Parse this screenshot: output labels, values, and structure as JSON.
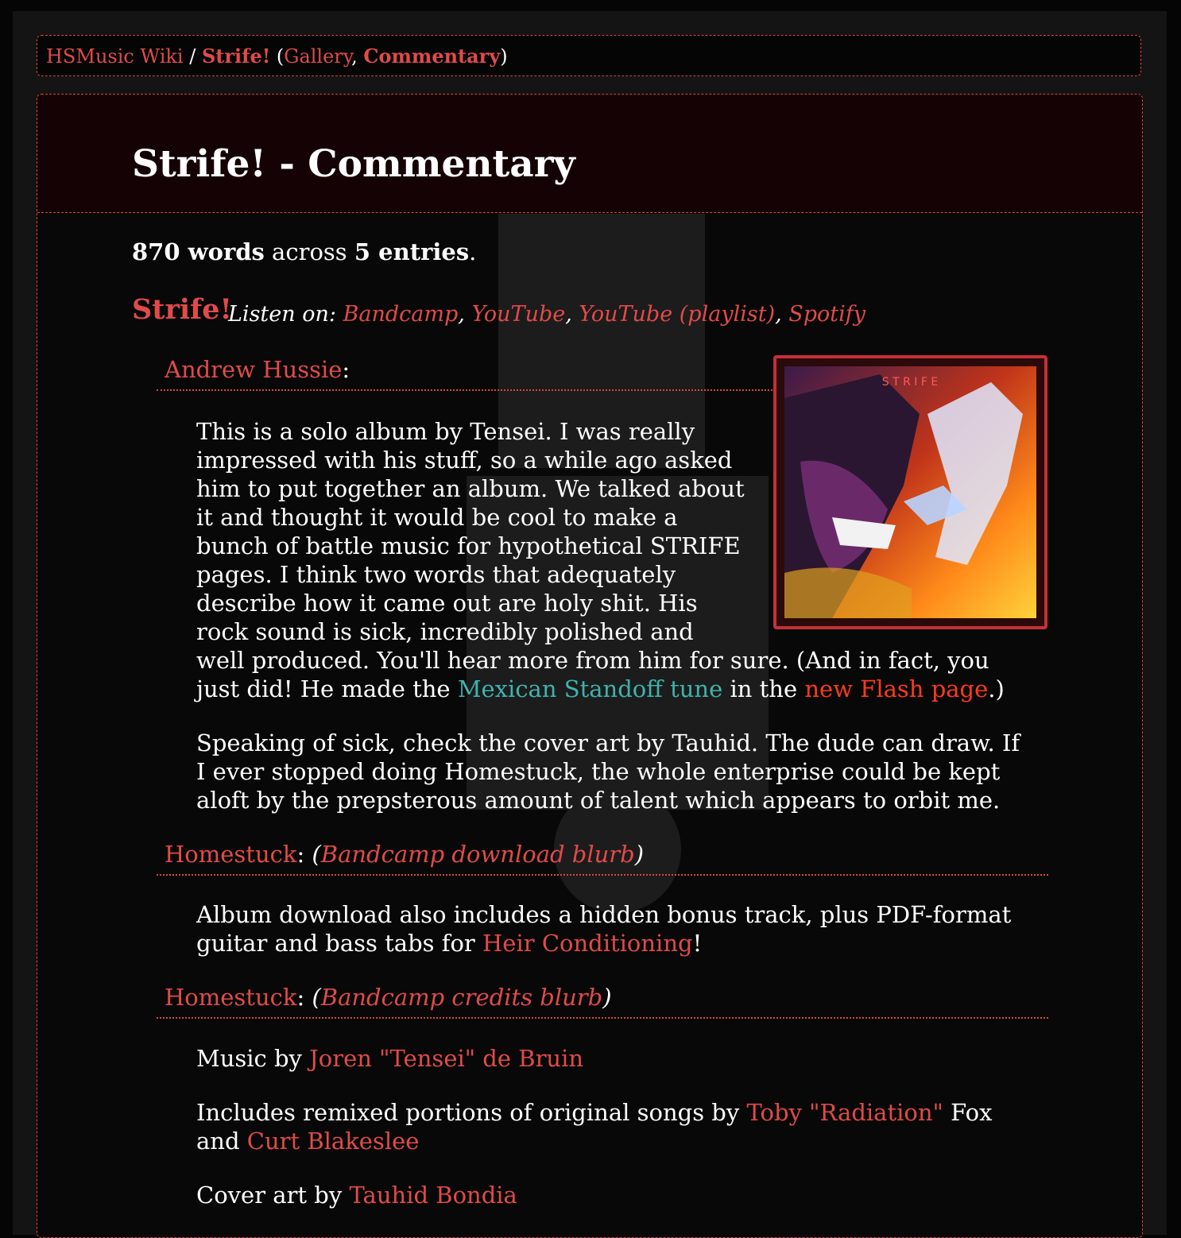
{
  "nav": {
    "wiki": "HSMusic Wiki",
    "sep": " / ",
    "album": "Strife!",
    "paren_open": " (",
    "gallery": "Gallery",
    "comma": ", ",
    "commentary": "Commentary",
    "paren_close": ")"
  },
  "header": {
    "title": "Strife! - Commentary"
  },
  "stats": {
    "words": "870 words",
    "across": " across ",
    "entries": "5 entries",
    "period": "."
  },
  "album": {
    "title": "Strife!",
    "listen_label": "Listen on: ",
    "links": [
      "Bandcamp",
      "YouTube",
      "YouTube (playlist)",
      "Spotify"
    ]
  },
  "cover": {
    "letters": "S T R I F E"
  },
  "entries": {
    "e1": {
      "artist": "Andrew Hussie",
      "colon": ":",
      "p1_a": "This is a solo album by Tensei. I was really impressed with his stuff, so a while ago asked him to put together an album. We talked about it and thought it would be cool to make a bunch of battle music for hypothetical STRIFE pages. I think two words that adequately describe how it came out are holy shit. His rock sound is sick, incredibly polished and well produced. You'll hear more from him for sure. (And in fact, you just did! He made the ",
      "p1_link1": "Mexican Standoff tune",
      "p1_mid": " in the ",
      "p1_link2": "new Flash page",
      "p1_end": ".)",
      "p2": "Speaking of sick, check the cover art by Tauhid. The dude can draw. If I ever stopped doing Homestuck, the whole enterprise could be kept aloft by the prepsterous amount of talent which appears to orbit me."
    },
    "e2": {
      "artist": "Homestuck",
      "colon": ": ",
      "source": "Bandcamp download blurb",
      "p1_a": "Album download also includes a hidden bonus track, plus PDF-format guitar and bass tabs for ",
      "p1_link": "Heir Conditioning",
      "p1_end": "!"
    },
    "e3": {
      "artist": "Homestuck",
      "colon": ": ",
      "source": "Bandcamp credits blurb",
      "l1_a": "Music by ",
      "l1_link": "Joren \"Tensei\" de Bruin",
      "l2_a": "Includes remixed portions of original songs by ",
      "l2_link1": "Toby \"Radiation\"",
      "l2_mid": " Fox and ",
      "l2_link2": "Curt Blakeslee",
      "l3_a": "Cover art by ",
      "l3_link": "Tauhid Bondia"
    }
  }
}
